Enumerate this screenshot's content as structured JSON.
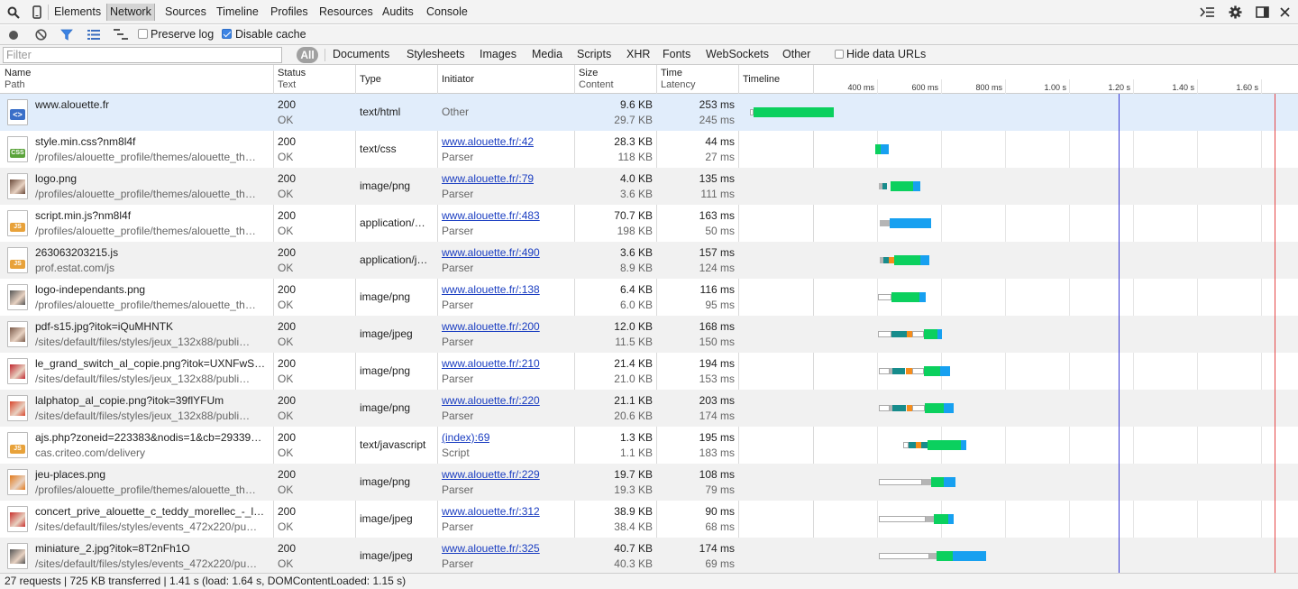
{
  "tabs": [
    "Elements",
    "Network",
    "Sources",
    "Timeline",
    "Profiles",
    "Resources",
    "Audits",
    "Console"
  ],
  "active_tab": "Network",
  "toolbar": {
    "preserve_log_label": "Preserve log",
    "preserve_log_checked": false,
    "disable_cache_label": "Disable cache",
    "disable_cache_checked": true
  },
  "filter": {
    "placeholder": "Filter",
    "all_label": "All",
    "types": [
      "Documents",
      "Stylesheets",
      "Images",
      "Media",
      "Scripts",
      "XHR",
      "Fonts",
      "WebSockets",
      "Other"
    ],
    "hide_data_urls_label": "Hide data URLs"
  },
  "columns": {
    "name": "Name",
    "path": "Path",
    "status": "Status",
    "text": "Text",
    "type": "Type",
    "initiator": "Initiator",
    "size": "Size",
    "content": "Content",
    "time": "Time",
    "latency": "Latency",
    "timeline": "Timeline"
  },
  "timeline_ticks": [
    "400 ms",
    "600 ms",
    "800 ms",
    "1.00 s",
    "1.20 s",
    "1.40 s",
    "1.60 s"
  ],
  "colors": {
    "dom_content_loaded_line": "#3a3ad6",
    "load_line": "#e64545",
    "receiving": "#17a0f0",
    "waiting": "#0bd05e"
  },
  "requests": [
    {
      "name": "www.alouette.fr",
      "path": "",
      "status": "200",
      "status_text": "OK",
      "type": "text/html",
      "initiator": "Other",
      "initiator_sub": "",
      "size": "9.6 KB",
      "content": "29.7 KB",
      "time": "253 ms",
      "latency": "245 ms",
      "icon": "html-file-icon"
    },
    {
      "name": "style.min.css?nm8l4f",
      "path": "/profiles/alouette_profile/themes/alouette_th…",
      "status": "200",
      "status_text": "OK",
      "type": "text/css",
      "initiator": "www.alouette.fr/:42",
      "initiator_sub": "Parser",
      "size": "28.3 KB",
      "content": "118 KB",
      "time": "44 ms",
      "latency": "27 ms",
      "icon": "css-file-icon"
    },
    {
      "name": "logo.png",
      "path": "/profiles/alouette_profile/themes/alouette_th…",
      "status": "200",
      "status_text": "OK",
      "type": "image/png",
      "initiator": "www.alouette.fr/:79",
      "initiator_sub": "Parser",
      "size": "4.0 KB",
      "content": "3.6 KB",
      "time": "135 ms",
      "latency": "111 ms",
      "icon": "image-thumbnail-icon"
    },
    {
      "name": "script.min.js?nm8l4f",
      "path": "/profiles/alouette_profile/themes/alouette_th…",
      "status": "200",
      "status_text": "OK",
      "type": "application/…",
      "initiator": "www.alouette.fr/:483",
      "initiator_sub": "Parser",
      "size": "70.7 KB",
      "content": "198 KB",
      "time": "163 ms",
      "latency": "50 ms",
      "icon": "js-file-icon"
    },
    {
      "name": "263063203215.js",
      "path": "prof.estat.com/js",
      "status": "200",
      "status_text": "OK",
      "type": "application/j…",
      "initiator": "www.alouette.fr/:490",
      "initiator_sub": "Parser",
      "size": "3.6 KB",
      "content": "8.9 KB",
      "time": "157 ms",
      "latency": "124 ms",
      "icon": "js-file-icon"
    },
    {
      "name": "logo-independants.png",
      "path": "/profiles/alouette_profile/themes/alouette_th…",
      "status": "200",
      "status_text": "OK",
      "type": "image/png",
      "initiator": "www.alouette.fr/:138",
      "initiator_sub": "Parser",
      "size": "6.4 KB",
      "content": "6.0 KB",
      "time": "116 ms",
      "latency": "95 ms",
      "icon": "image-thumbnail-icon"
    },
    {
      "name": "pdf-s15.jpg?itok=iQuMHNTK",
      "path": "/sites/default/files/styles/jeux_132x88/publi…",
      "status": "200",
      "status_text": "OK",
      "type": "image/jpeg",
      "initiator": "www.alouette.fr/:200",
      "initiator_sub": "Parser",
      "size": "12.0 KB",
      "content": "11.5 KB",
      "time": "168 ms",
      "latency": "150 ms",
      "icon": "image-thumbnail-icon"
    },
    {
      "name": "le_grand_switch_al_copie.png?itok=UXNFwSQY",
      "path": "/sites/default/files/styles/jeux_132x88/publi…",
      "status": "200",
      "status_text": "OK",
      "type": "image/png",
      "initiator": "www.alouette.fr/:210",
      "initiator_sub": "Parser",
      "size": "21.4 KB",
      "content": "21.0 KB",
      "time": "194 ms",
      "latency": "153 ms",
      "icon": "image-thumbnail-icon"
    },
    {
      "name": "lalphatop_al_copie.png?itok=39flYFUm",
      "path": "/sites/default/files/styles/jeux_132x88/publi…",
      "status": "200",
      "status_text": "OK",
      "type": "image/png",
      "initiator": "www.alouette.fr/:220",
      "initiator_sub": "Parser",
      "size": "21.1 KB",
      "content": "20.6 KB",
      "time": "203 ms",
      "latency": "174 ms",
      "icon": "image-thumbnail-icon"
    },
    {
      "name": "ajs.php?zoneid=223383&nodis=1&cb=29339…",
      "path": "cas.criteo.com/delivery",
      "status": "200",
      "status_text": "OK",
      "type": "text/javascript",
      "initiator": "(index):69",
      "initiator_sub": "Script",
      "size": "1.3 KB",
      "content": "1.1 KB",
      "time": "195 ms",
      "latency": "183 ms",
      "icon": "js-file-icon"
    },
    {
      "name": "jeu-places.png",
      "path": "/profiles/alouette_profile/themes/alouette_th…",
      "status": "200",
      "status_text": "OK",
      "type": "image/png",
      "initiator": "www.alouette.fr/:229",
      "initiator_sub": "Parser",
      "size": "19.7 KB",
      "content": "19.3 KB",
      "time": "108 ms",
      "latency": "79 ms",
      "icon": "image-thumbnail-icon"
    },
    {
      "name": "concert_prive_alouette_c_teddy_morellec_-_la…",
      "path": "/sites/default/files/styles/events_472x220/pu…",
      "status": "200",
      "status_text": "OK",
      "type": "image/jpeg",
      "initiator": "www.alouette.fr/:312",
      "initiator_sub": "Parser",
      "size": "38.9 KB",
      "content": "38.4 KB",
      "time": "90 ms",
      "latency": "68 ms",
      "icon": "image-thumbnail-icon"
    },
    {
      "name": "miniature_2.jpg?itok=8T2nFh1O",
      "path": "/sites/default/files/styles/events_472x220/pu…",
      "status": "200",
      "status_text": "OK",
      "type": "image/jpeg",
      "initiator": "www.alouette.fr/:325",
      "initiator_sub": "Parser",
      "size": "40.7 KB",
      "content": "40.3 KB",
      "time": "174 ms",
      "latency": "69 ms",
      "icon": "image-thumbnail-icon"
    }
  ],
  "status_bar": "27 requests | 725 KB transferred | 1.41 s (load: 1.64 s, DOMContentLoaded: 1.15 s)"
}
